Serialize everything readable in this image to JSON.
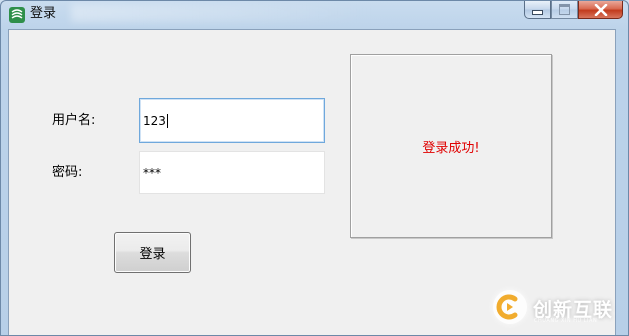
{
  "window": {
    "title": "登录",
    "icon": "app-icon"
  },
  "titlebar_buttons": [
    {
      "name": "minimize-button",
      "icon": "minimize-icon"
    },
    {
      "name": "maximize-button",
      "icon": "maximize-icon"
    },
    {
      "name": "close-button",
      "icon": "close-icon"
    }
  ],
  "form": {
    "username_label": "用户名:",
    "username_value": "123",
    "password_label": "密码:",
    "password_value": "***",
    "login_button_label": "登录"
  },
  "result": {
    "message": "登录成功!",
    "color": "#e00000"
  },
  "watermark": {
    "text": "创新互联",
    "subtext": "CHUANG XIN HU LIAN",
    "icon": "chuangxin-logo-icon"
  }
}
